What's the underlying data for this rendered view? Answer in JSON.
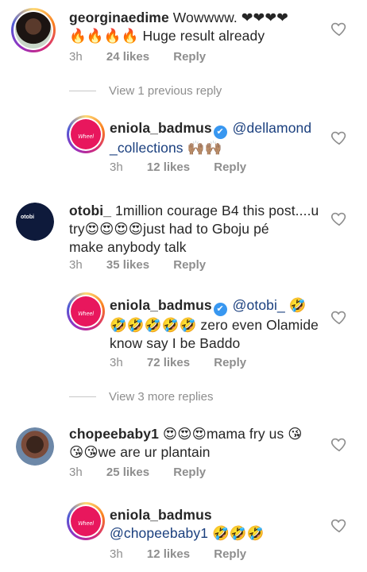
{
  "comments": [
    {
      "username": "georginaedime",
      "text_line1": " Wowwww. ❤❤❤❤",
      "text_line2": "🔥🔥🔥🔥 Huge result already",
      "time": "3h",
      "likes": "24 likes",
      "reply": "Reply"
    },
    {
      "view_replies": "View 1 previous reply"
    },
    {
      "username": "eniola_badmus",
      "verified": "✔",
      "mention": "@dellamond",
      "text_line2_mention": "_collections",
      "text_line2_tail": " 🙌🏽🙌🏽",
      "time": "3h",
      "likes": "12 likes",
      "reply": "Reply",
      "avatar_text": "Wheel"
    },
    {
      "username": "otobi_",
      "text_line1": " 1million courage B4 this post....u",
      "text_line2": "try😍😍😍😍just had to Gboju pé",
      "text_line3": "make anybody talk",
      "time": "3h",
      "likes": "35 likes",
      "reply": "Reply",
      "avatar_text": "otobi"
    },
    {
      "username": "eniola_badmus",
      "verified": "✔",
      "mention": "@otobi_",
      "text_line1_tail": " 🤣",
      "text_line2": "🤣🤣🤣🤣🤣 zero even Olamide",
      "text_line3": "know say I be Baddo",
      "time": "3h",
      "likes": "72 likes",
      "reply": "Reply",
      "avatar_text": "Wheel"
    },
    {
      "view_replies": "View 3 more replies"
    },
    {
      "username": "chopeebaby1",
      "text_line1": " 😍😍😍mama  fry us 😘",
      "text_line2": "😘😘we are ur plantain",
      "time": "3h",
      "likes": "25 likes",
      "reply": "Reply"
    },
    {
      "username": "eniola_badmus",
      "mention": "@chopeebaby1",
      "text_line2_tail": " 🤣🤣🤣",
      "time": "3h",
      "likes": "12 likes",
      "reply": "Reply",
      "avatar_text": "Wheel"
    }
  ],
  "colors": {
    "mention": "#1a3f7e",
    "meta": "#8e8e8e",
    "verified": "#3897f0",
    "eniola_avatar": "#e8175d"
  },
  "icons": [
    "heart-icon",
    "verified-badge-icon"
  ]
}
